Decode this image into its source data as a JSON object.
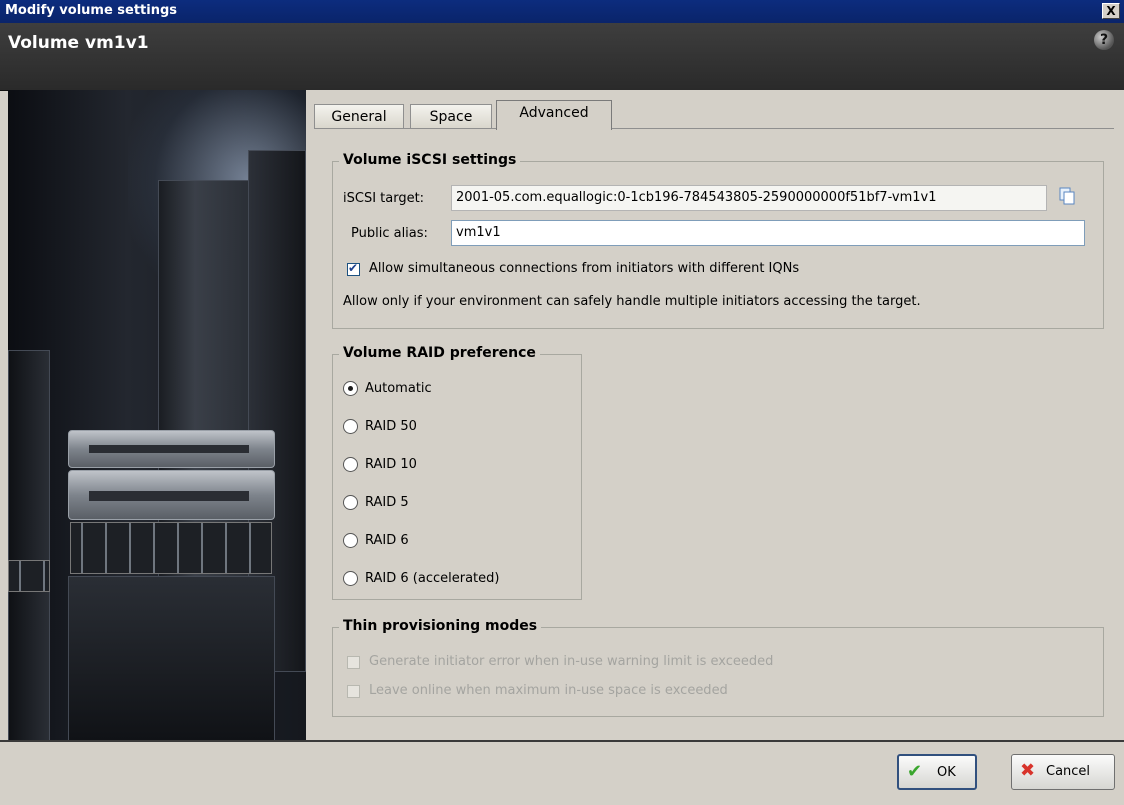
{
  "window": {
    "title": "Modify volume settings",
    "close_glyph": "X"
  },
  "header": {
    "title": "Volume vm1v1",
    "help_glyph": "?"
  },
  "tabs": [
    {
      "label": "General"
    },
    {
      "label": "Space"
    },
    {
      "label": "Advanced"
    }
  ],
  "active_tab": "Advanced",
  "iscsi": {
    "legend": "Volume iSCSI settings",
    "target_label": "iSCSI target:",
    "target_value": "2001-05.com.equallogic:0-1cb196-784543805-2590000000f51bf7-vm1v1",
    "alias_label": "Public alias:",
    "alias_value": "vm1v1",
    "allow_label": "Allow simultaneous connections from initiators with different IQNs",
    "allow_checked": true,
    "note": "Allow only if your environment can safely handle multiple initiators accessing the target."
  },
  "raid": {
    "legend": "Volume RAID preference",
    "options": [
      "Automatic",
      "RAID 50",
      "RAID 10",
      "RAID 5",
      "RAID 6",
      "RAID 6 (accelerated)"
    ],
    "selected": "Automatic"
  },
  "thin": {
    "legend": "Thin provisioning modes",
    "options": [
      {
        "label": "Generate initiator error when in-use warning limit is exceeded",
        "checked": false,
        "enabled": false
      },
      {
        "label": "Leave online when maximum in-use space is exceeded",
        "checked": false,
        "enabled": false
      }
    ]
  },
  "buttons": {
    "ok": "OK",
    "cancel": "Cancel"
  },
  "icons": {
    "close": "close-icon",
    "help": "help-icon",
    "copy": "copy-icon",
    "ok": "checkmark-icon",
    "cancel": "cancel-x-icon"
  },
  "colors": {
    "title_bar": "#0a246a",
    "header_bg": "#333333",
    "dialog_bg": "#d4d0c8",
    "ok_check": "#3aa62e",
    "cancel_x": "#d8332b"
  }
}
